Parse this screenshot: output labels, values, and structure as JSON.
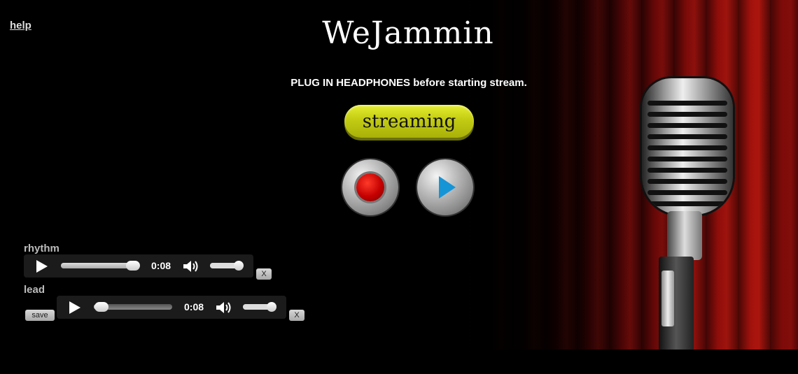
{
  "app": {
    "title": "WeJammin"
  },
  "nav": {
    "help_label": "help"
  },
  "notice": "PLUG IN HEADPHONES before starting stream.",
  "controls": {
    "stream_label": "streaming",
    "record_icon": "record-icon",
    "play_icon": "play-icon"
  },
  "tracks": [
    {
      "label": "rhythm",
      "time": "0:08",
      "progress": 0.92,
      "volume": 0.9,
      "remove_label": "X"
    },
    {
      "label": "lead",
      "time": "0:08",
      "progress": 0.1,
      "volume": 0.9,
      "remove_label": "X",
      "save_label": "save"
    }
  ],
  "colors": {
    "stream_button": "#c3cc12",
    "record": "#c40000",
    "play": "#1594d6",
    "curtain": "#a3120c"
  }
}
